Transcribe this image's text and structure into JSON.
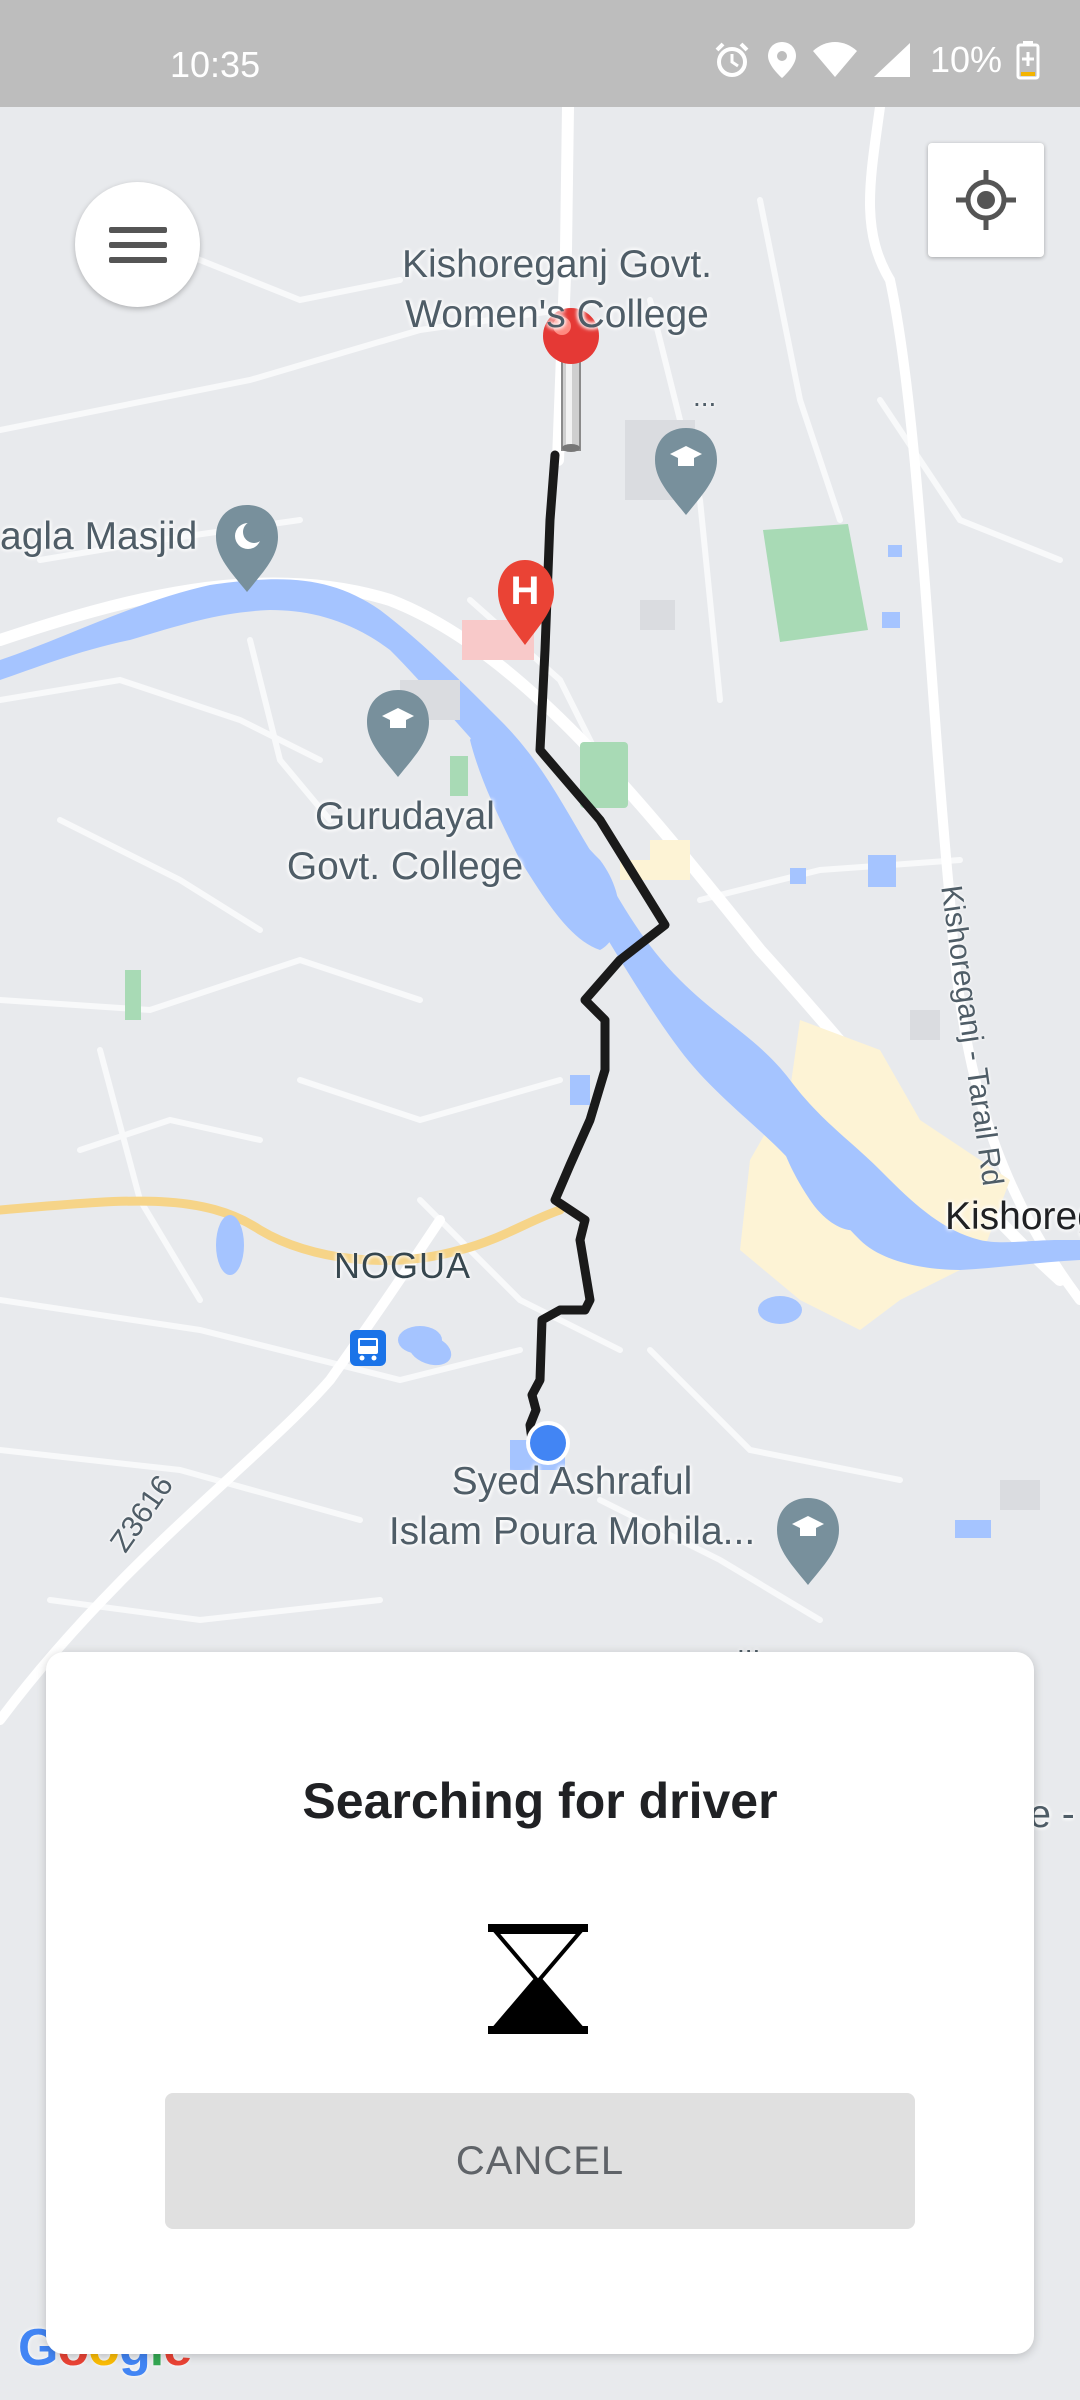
{
  "status_bar": {
    "time": "10:35",
    "battery": "10%",
    "icons": [
      "alarm-icon",
      "location-icon",
      "wifi-icon",
      "signal-icon",
      "battery-icon"
    ]
  },
  "map": {
    "labels": {
      "womens_college": "Kishoreganj Govt.\nWomen's College",
      "masjid": "agla Masjid",
      "gurudayal": "Gurudayal\nGovt. College",
      "nogua": "NOGUA",
      "syed": "Syed Ashraful\nIslam Poura Mohila...",
      "kishoreg": "Kishoreg",
      "tarail_rd": "Kishoreganj - Tarail Rd",
      "z3616": "Z3616",
      "edge_fragment": "e -"
    },
    "dots": "..."
  },
  "controls": {
    "menu_icon": "menu-icon",
    "locate_icon": "my-location-icon"
  },
  "google_logo": "Google",
  "sheet": {
    "title": "Searching for driver",
    "cancel_label": "CANCEL"
  },
  "colors": {
    "route": "#1a1a1a",
    "water": "#a5c4ff",
    "pin": "#e53935",
    "user_dot": "#4285f4",
    "park": "#a8dab5"
  }
}
